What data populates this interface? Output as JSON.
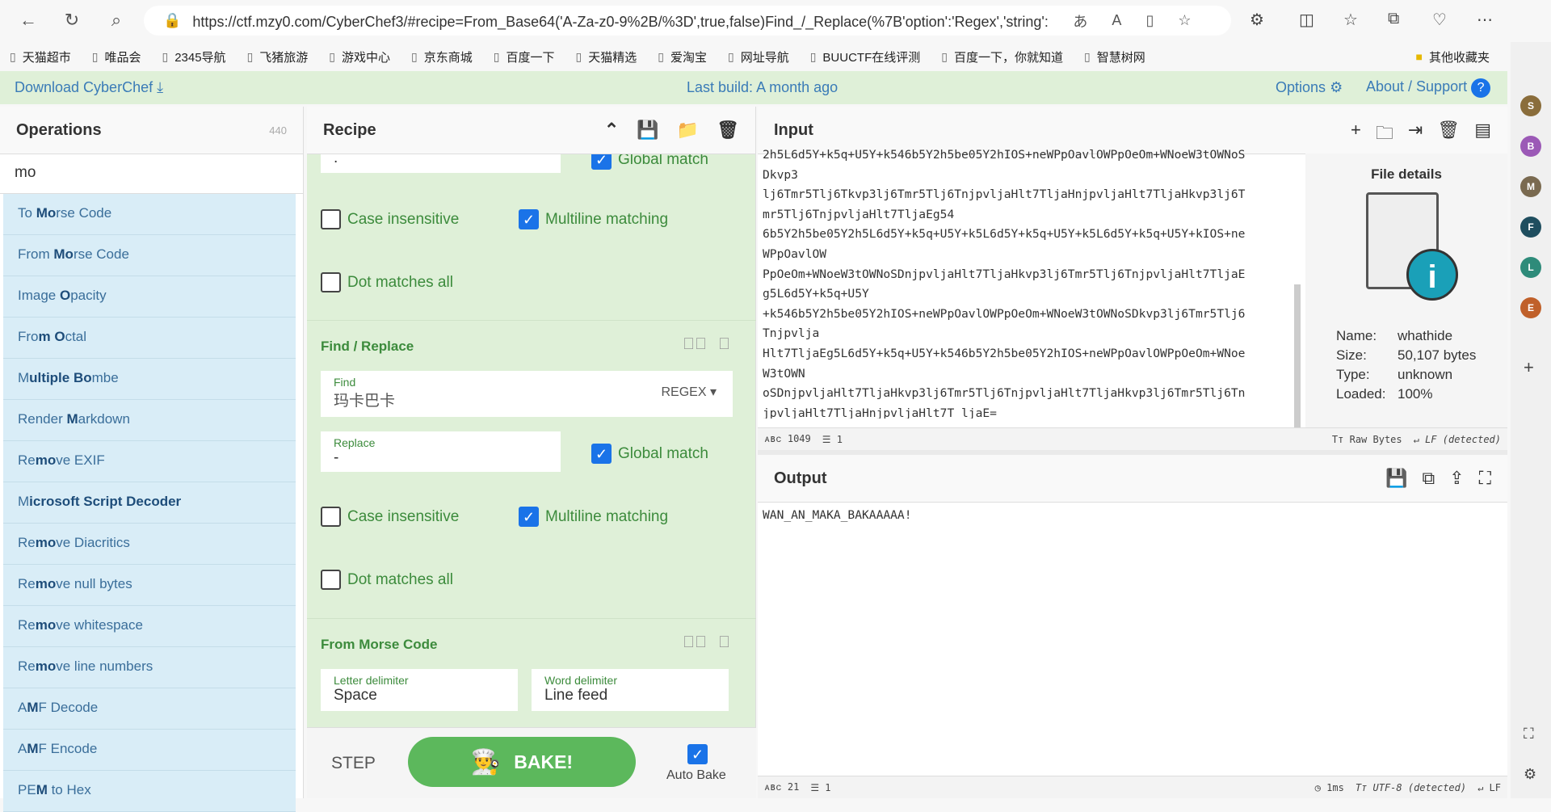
{
  "browser": {
    "url": "https://ctf.mzy0.com/CyberChef3/#recipe=From_Base64('A-Za-z0-9%2B/%3D',true,false)Find_/_Replace(%7B'option':'Regex','string':'依古...",
    "bookmarks": [
      "天猫超市",
      "唯品会",
      "2345导航",
      "飞猪旅游",
      "游戏中心",
      "京东商城",
      "百度一下",
      "天猫精选",
      "爱淘宝",
      "网址导航",
      "BUUCTF在线评测",
      "百度一下，你就知道",
      "智慧树网"
    ],
    "other_bookmarks": "其他收藏夹",
    "profiles": [
      {
        "letter": "S",
        "color": "#8a6d3b"
      },
      {
        "letter": "B",
        "color": "#9b59b6"
      },
      {
        "letter": "M",
        "color": "#7a6a50"
      },
      {
        "letter": "F",
        "color": "#1f4e5f"
      },
      {
        "letter": "L",
        "color": "#2e8b7a"
      },
      {
        "letter": "E",
        "color": "#c0602a"
      }
    ]
  },
  "banner": {
    "download": "Download CyberChef",
    "last_build": "Last build: A month ago",
    "options": "Options",
    "about": "About / Support"
  },
  "operations": {
    "title": "Operations",
    "count": "440",
    "search": "mo",
    "items": [
      [
        "To ",
        "Mo",
        "rse Code"
      ],
      [
        "From ",
        "Mo",
        "rse Code"
      ],
      [
        "Image ",
        "O",
        "pacity"
      ],
      [
        "Fro",
        "m O",
        "ctal"
      ],
      [
        "M",
        "ultiple Bo",
        "mbe"
      ],
      [
        "Render ",
        "M",
        "arkdown"
      ],
      [
        "Re",
        "mo",
        "ve EXIF"
      ],
      [
        "M",
        "icrosoft Script Decoder",
        ""
      ],
      [
        "Re",
        "mo",
        "ve Diacritics"
      ],
      [
        "Re",
        "mo",
        "ve null bytes"
      ],
      [
        "Re",
        "mo",
        "ve whitespace"
      ],
      [
        "Re",
        "mo",
        "ve line numbers"
      ],
      [
        "A",
        "M",
        "F Decode"
      ],
      [
        "A",
        "M",
        "F Encode"
      ],
      [
        "PE",
        "M",
        " to Hex"
      ]
    ]
  },
  "recipe": {
    "title": "Recipe",
    "op1": {
      "replace_value": ".",
      "global_match": "Global match",
      "case_insensitive": "Case insensitive",
      "multiline": "Multiline matching",
      "dot_all": "Dot matches all"
    },
    "op2": {
      "title": "Find / Replace",
      "find_label": "Find",
      "find_value": "玛卡巴卡",
      "find_mode": "REGEX",
      "replace_label": "Replace",
      "replace_value": "-",
      "global_match": "Global match",
      "case_insensitive": "Case insensitive",
      "multiline": "Multiline matching",
      "dot_all": "Dot matches all"
    },
    "op3": {
      "title": "From Morse Code",
      "letter_label": "Letter delimiter",
      "letter_value": "Space",
      "word_label": "Word delimiter",
      "word_value": "Line feed"
    },
    "step": "STEP",
    "bake": "BAKE!",
    "auto_bake": "Auto Bake"
  },
  "input": {
    "title": "Input",
    "lines": [
      "2h5L6d5Y+k5q+U5Y+k546b5Y2h5be05Y2hIOS+neWPpOavlOWPpOeOm+WNoeW3tOWNoS",
      "Dkvp3",
      "lj6Tmr5Tlj6Tkvp3lj6Tmr5Tlj6TnjpvljaHlt7TljaHnjpvljaHlt7TljaHkvp3lj6T",
      "mr5Tlj6TnjpvljaHlt7TljaEg54",
      "6b5Y2h5be05Y2h5L6d5Y+k5q+U5Y+k5L6d5Y+k5q+U5Y+k5L6d5Y+k5q+U5Y+kIOS+ne",
      "WPpOavlOW",
      "PpOeOm+WNoeW3tOWNoSDnjpvljaHlt7TljaHkvp3lj6Tmr5Tlj6TnjpvljaHlt7TljaE",
      "g5L6d5Y+k5q+U5Y",
      "+k546b5Y2h5be05Y2hIOS+neWPpOavlOWPpOeOm+WNoeW3tOWNoSDkvp3lj6Tmr5Tlj6",
      "Tnjpvlja",
      "Hlt7TljaEg5L6d5Y+k5q+U5Y+k546b5Y2h5be05Y2hIOS+neWPpOavlOWPpOeOm+WNoe",
      "W3tOWN",
      "oSDnjpvljaHlt7TljaHkvp3lj6Tmr5Tlj6TnjpvljaHlt7TljaHkvp3lj6Tmr5Tlj6Tn",
      "jpvljaHlt7TljaHnjpvljaHlt7T ljaE="
    ],
    "file": {
      "heading": "File details",
      "name_label": "Name:",
      "name": "whathide",
      "size_label": "Size:",
      "size": "50,107 bytes",
      "type_label": "Type:",
      "type": "unknown",
      "loaded_label": "Loaded:",
      "loaded": "100%"
    },
    "status": {
      "chars": "1049",
      "lines": "1",
      "encoding": "Raw Bytes",
      "eol": "LF (detected)"
    }
  },
  "output": {
    "title": "Output",
    "text": "WAN_AN_MAKA_BAKAAAAA!",
    "status": {
      "chars": "21",
      "lines": "1",
      "time": "1ms",
      "encoding": "UTF-8 (detected)",
      "eol": "LF"
    }
  }
}
